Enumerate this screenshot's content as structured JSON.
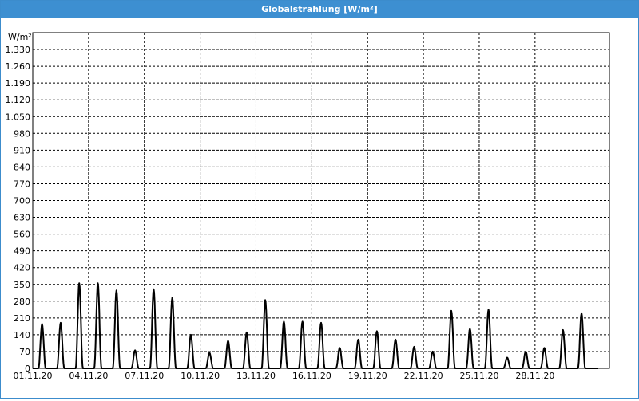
{
  "window": {
    "title": "Globalstrahlung [W/m²]"
  },
  "chart_data": {
    "type": "line",
    "title": "Globalstrahlung [W/m²]",
    "ylabel": "W/m²",
    "xlabel": "",
    "ylim": [
      0,
      1400
    ],
    "grid": true,
    "legend": "none",
    "x_unit": "date",
    "x_range": [
      "2020-11-01",
      "2020-11-30"
    ],
    "y_ticks": [
      "0",
      "70",
      "140",
      "210",
      "280",
      "350",
      "420",
      "490",
      "560",
      "630",
      "700",
      "770",
      "840",
      "910",
      "980",
      "1.050",
      "1.120",
      "1.190",
      "1.260",
      "1.330"
    ],
    "y_tick_values": [
      0,
      70,
      140,
      210,
      280,
      350,
      420,
      490,
      560,
      630,
      700,
      770,
      840,
      910,
      980,
      1050,
      1120,
      1190,
      1260,
      1330
    ],
    "x_ticks": [
      "01.11.20",
      "04.11.20",
      "07.11.20",
      "10.11.20",
      "13.11.20",
      "16.11.20",
      "19.11.20",
      "22.11.20",
      "25.11.20",
      "28.11.20"
    ],
    "series": [
      {
        "color": "#000000",
        "daily_peaks": [
          {
            "date": "2020-11-01",
            "peak": 185
          },
          {
            "date": "2020-11-02",
            "peak": 190
          },
          {
            "date": "2020-11-03",
            "peak": 355
          },
          {
            "date": "2020-11-04",
            "peak": 355
          },
          {
            "date": "2020-11-05",
            "peak": 325
          },
          {
            "date": "2020-11-06",
            "peak": 75
          },
          {
            "date": "2020-11-07",
            "peak": 330
          },
          {
            "date": "2020-11-08",
            "peak": 295
          },
          {
            "date": "2020-11-09",
            "peak": 140
          },
          {
            "date": "2020-11-10",
            "peak": 65
          },
          {
            "date": "2020-11-11",
            "peak": 115
          },
          {
            "date": "2020-11-12",
            "peak": 150
          },
          {
            "date": "2020-11-13",
            "peak": 285
          },
          {
            "date": "2020-11-14",
            "peak": 195
          },
          {
            "date": "2020-11-15",
            "peak": 195
          },
          {
            "date": "2020-11-16",
            "peak": 190
          },
          {
            "date": "2020-11-17",
            "peak": 85
          },
          {
            "date": "2020-11-18",
            "peak": 120
          },
          {
            "date": "2020-11-19",
            "peak": 155
          },
          {
            "date": "2020-11-20",
            "peak": 120
          },
          {
            "date": "2020-11-21",
            "peak": 90
          },
          {
            "date": "2020-11-22",
            "peak": 70
          },
          {
            "date": "2020-11-23",
            "peak": 240
          },
          {
            "date": "2020-11-24",
            "peak": 165
          },
          {
            "date": "2020-11-25",
            "peak": 245
          },
          {
            "date": "2020-11-26",
            "peak": 45
          },
          {
            "date": "2020-11-27",
            "peak": 70
          },
          {
            "date": "2020-11-28",
            "peak": 85
          },
          {
            "date": "2020-11-29",
            "peak": 160
          },
          {
            "date": "2020-11-30",
            "peak": 230
          }
        ]
      }
    ]
  }
}
